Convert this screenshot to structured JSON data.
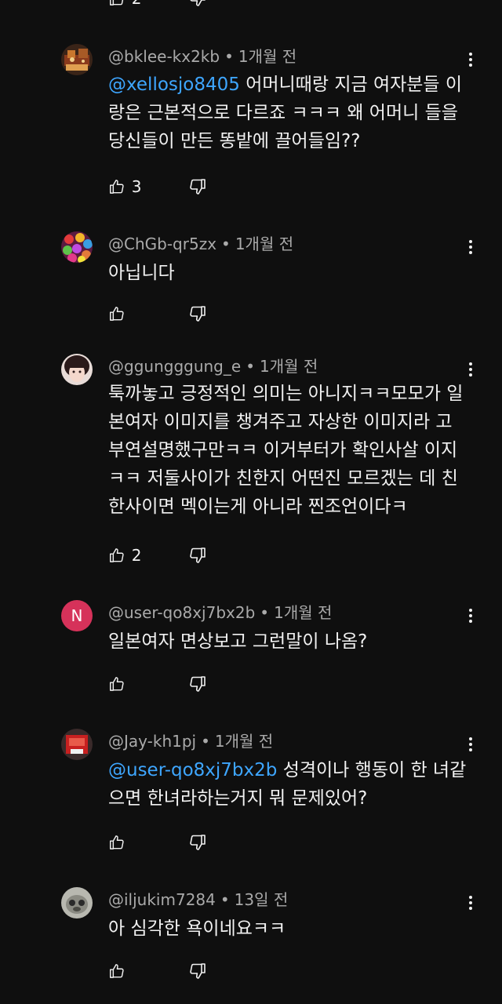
{
  "top_fragment": {
    "like_count": "2"
  },
  "comments": [
    {
      "handle": "@bklee-kx2kb",
      "time": "1개월 전",
      "mention": "@xellosjo8405",
      "text": " 어머니때랑 지금 여자분들 이랑은 근본적으로 다르죠 ㅋㅋㅋ 왜 어머니 들을 당신들이 만든 똥밭에 끌어들임??",
      "like_count": "3"
    },
    {
      "handle": "@ChGb-qr5zx",
      "time": "1개월 전",
      "mention": "",
      "text": "아닙니다",
      "like_count": ""
    },
    {
      "handle": "@ggungggung_e",
      "time": "1개월 전",
      "mention": "",
      "text": "툭까놓고 긍정적인 의미는 아니지ㅋㅋ모모가 일본여자 이미지를 챙겨주고 자상한 이미지라 고 부연설명했구만ㅋㅋ 이거부터가 확인사살 이지ㅋㅋ 저둘사이가 친한지 어떤진 모르겠는 데 친한사이면 멕이는게 아니라 찐조언이다ㅋ",
      "like_count": "2"
    },
    {
      "handle": "@user-qo8xj7bx2b",
      "time": "1개월 전",
      "avatar_letter": "N",
      "mention": "",
      "text": "일본여자 면상보고 그런말이 나옴?",
      "like_count": ""
    },
    {
      "handle": "@Jay-kh1pj",
      "time": "1개월 전",
      "mention": "@user-qo8xj7bx2b",
      "text": "  성격이나 행동이 한 녀같으면 한녀라하는거지 뭐 문제있어?",
      "like_count": ""
    },
    {
      "handle": "@iljukim7284",
      "time": "13일 전",
      "mention": "",
      "text": "아  심각한 욕이네요ㅋㅋ",
      "like_count": ""
    }
  ],
  "colors": {
    "background": "#0f0f0f",
    "text": "#f1f1f1",
    "meta": "#aaaaaa",
    "mention": "#3ea6ff",
    "avatar_n": "#d6325a"
  },
  "icons": [
    "like-icon",
    "dislike-icon",
    "more-vert-icon"
  ]
}
